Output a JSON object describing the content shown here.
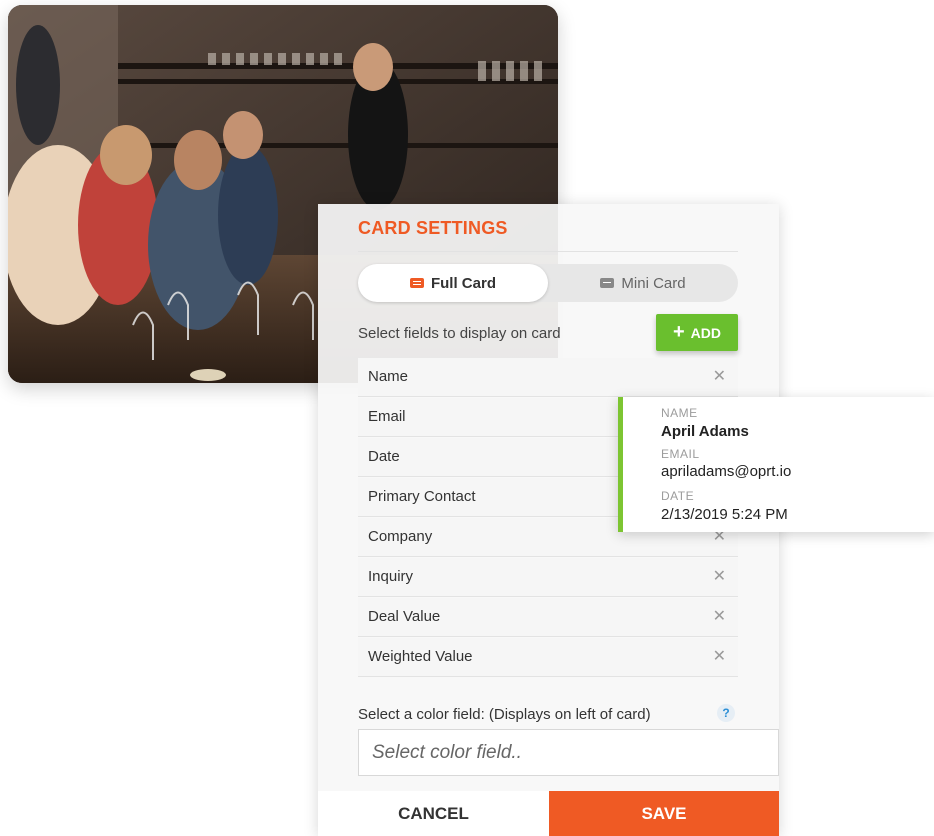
{
  "panel": {
    "title": "CARD SETTINGS",
    "toggle": {
      "full_label": "Full Card",
      "mini_label": "Mini Card",
      "selected": "Full Card"
    },
    "fields_label": "Select fields to display on card",
    "add_label": "ADD",
    "fields": [
      {
        "label": "Name"
      },
      {
        "label": "Email"
      },
      {
        "label": "Date"
      },
      {
        "label": "Primary Contact"
      },
      {
        "label": "Company"
      },
      {
        "label": "Inquiry"
      },
      {
        "label": "Deal Value"
      },
      {
        "label": "Weighted Value"
      }
    ],
    "remove_glyph": "✕",
    "color_label": "Select a color field: (Displays on left of card)",
    "help_glyph": "?",
    "color_placeholder": "Select color field..",
    "cancel_label": "CANCEL",
    "save_label": "SAVE"
  },
  "preview": {
    "name_key": "NAME",
    "name_value": "April Adams",
    "email_key": "EMAIL",
    "email_value": "apriladams@oprt.io",
    "date_key": "DATE",
    "date_value": "2/13/2019 5:24 PM"
  },
  "colors": {
    "accent": "#ef5a24",
    "add_green": "#6abf2e",
    "preview_stripe": "#7dc532",
    "help_blue": "#2c8fd6"
  }
}
